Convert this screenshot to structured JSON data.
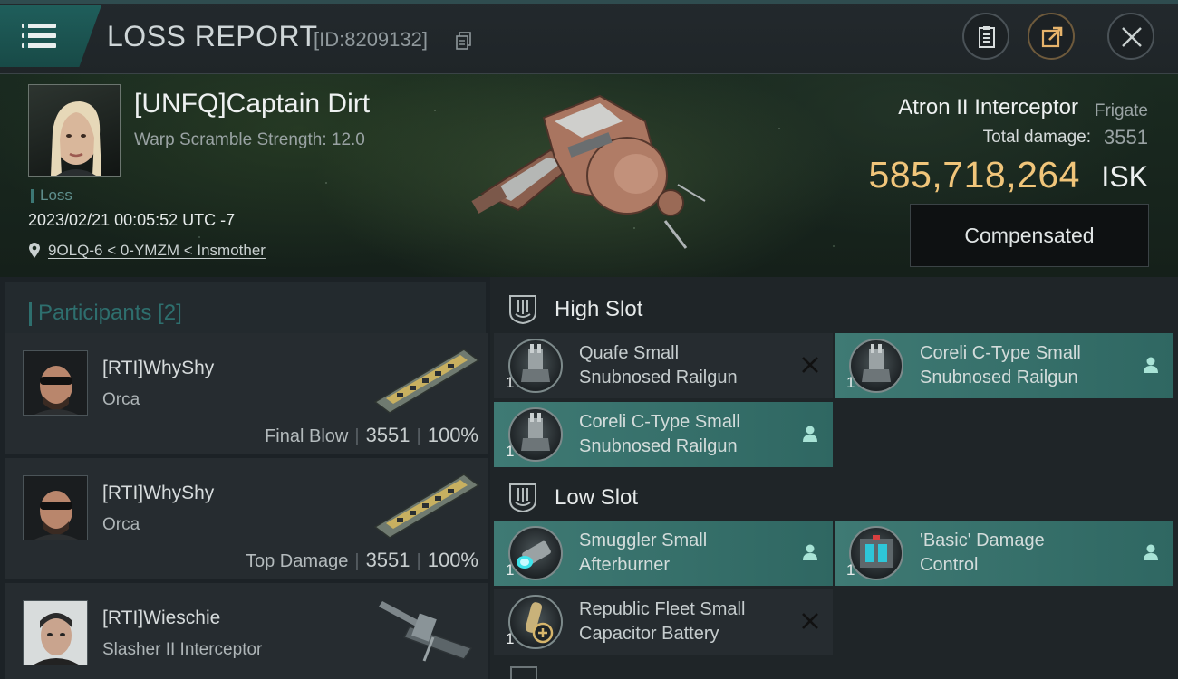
{
  "header": {
    "title": "LOSS REPORT",
    "report_id": "[ID:8209132]"
  },
  "victim": {
    "name": "[UNFQ]Captain Dirt",
    "warp_scramble": "Warp Scramble Strength: 12.0",
    "status": "Loss",
    "datetime": "2023/02/21 00:05:52 UTC -7",
    "location": "9OLQ-6 < 0-YMZM < Insmother",
    "ship_name": "Atron II Interceptor",
    "ship_class": "Frigate",
    "total_damage_label": "Total damage:",
    "total_damage": "3551",
    "isk_value": "585,718,264",
    "isk_unit": "ISK",
    "compensation_button": "Compensated"
  },
  "participants": {
    "title": "Participants [2]",
    "rows": [
      {
        "name": "[RTI]WhyShy",
        "ship": "Orca",
        "role": "Final Blow",
        "damage": "3551",
        "percent": "100%"
      },
      {
        "name": "[RTI]WhyShy",
        "ship": "Orca",
        "role": "Top Damage",
        "damage": "3551",
        "percent": "100%"
      },
      {
        "name": "[RTI]Wieschie",
        "ship": "Slasher II Interceptor"
      }
    ]
  },
  "fitting": {
    "high_slot": {
      "title": "High Slot",
      "modules": [
        {
          "line1": "Quafe Small",
          "line2": "Snubnosed Railgun",
          "qty": "1",
          "state": "destroyed"
        },
        {
          "line1": "Coreli C-Type Small",
          "line2": "Snubnosed Railgun",
          "qty": "1",
          "state": "dropped"
        },
        {
          "line1": "Coreli C-Type Small",
          "line2": "Snubnosed Railgun",
          "qty": "1",
          "state": "dropped"
        }
      ]
    },
    "low_slot": {
      "title": "Low Slot",
      "modules": [
        {
          "line1": "Smuggler Small",
          "line2": "Afterburner",
          "qty": "1",
          "state": "dropped"
        },
        {
          "line1": "'Basic' Damage",
          "line2": "Control",
          "qty": "1",
          "state": "dropped"
        },
        {
          "line1": "Republic Fleet Small",
          "line2": "Capacitor Battery",
          "qty": "1",
          "state": "destroyed"
        }
      ]
    }
  },
  "colors": {
    "accent_teal": "#3f7a74",
    "isk_gold": "#f0c57a",
    "header_teal": "#1f5e5b"
  },
  "icons": [
    "menu-icon",
    "copy-icon",
    "clipboard-icon",
    "share-icon",
    "close-icon",
    "location-pin-icon",
    "slot-icon",
    "destroyed-x-icon",
    "dropped-person-icon"
  ]
}
